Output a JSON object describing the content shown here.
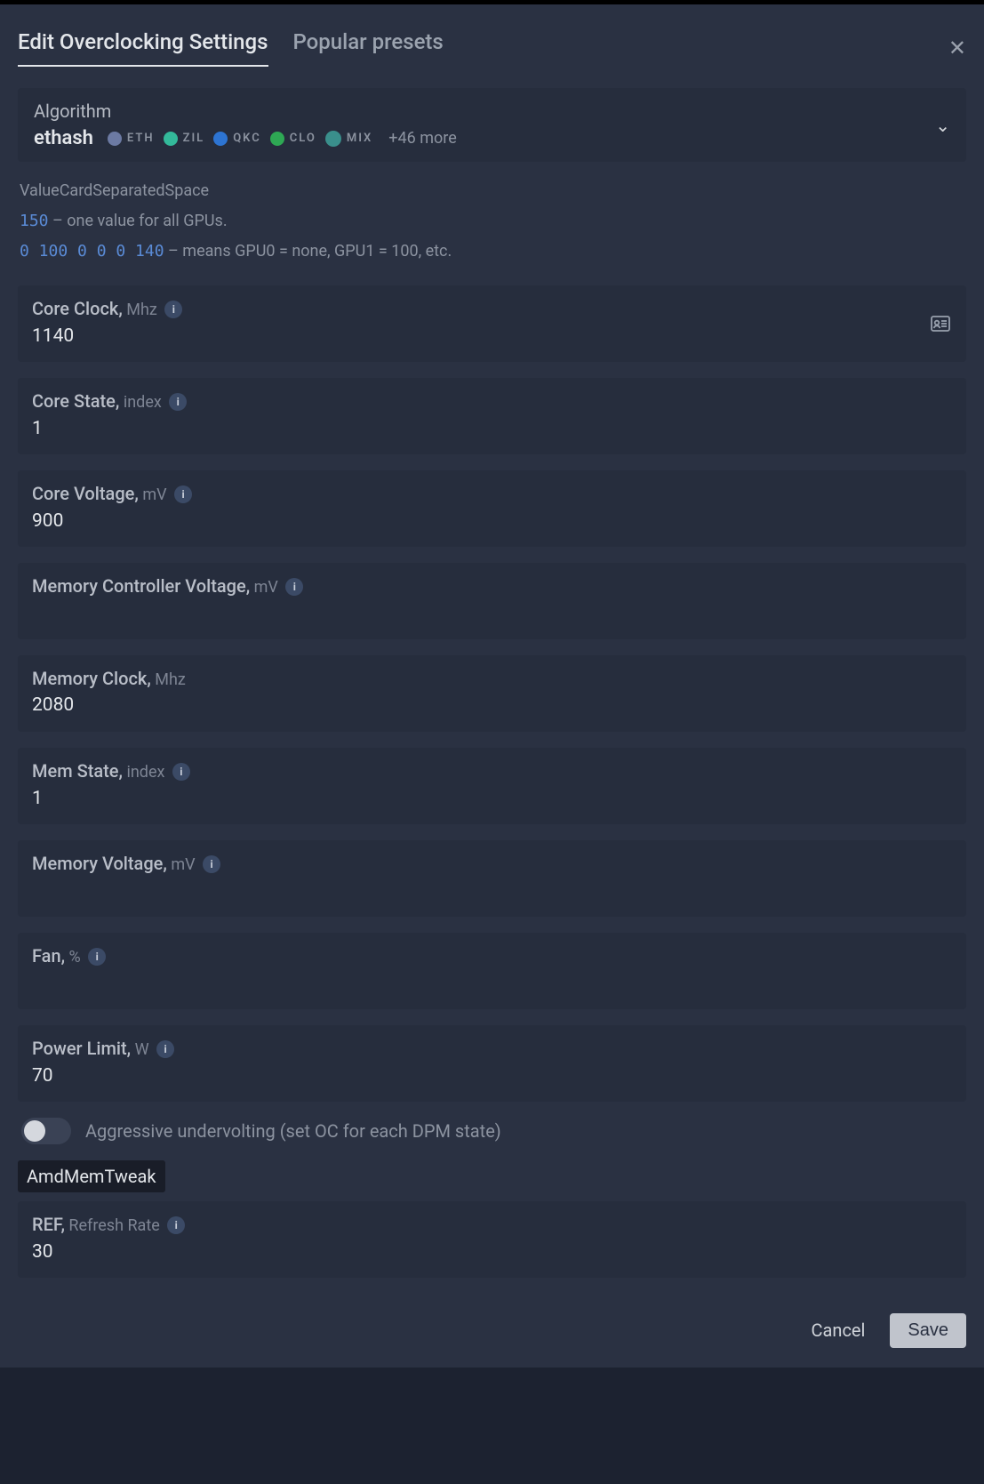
{
  "tabs": {
    "active": "Edit Overclocking Settings",
    "inactive": "Popular presets"
  },
  "algorithm": {
    "label": "Algorithm",
    "name": "ethash",
    "coins": [
      {
        "symbol": "ETH",
        "class": "eth"
      },
      {
        "symbol": "ZIL",
        "class": "zil"
      },
      {
        "symbol": "QKC",
        "class": "qkc"
      },
      {
        "symbol": "CLO",
        "class": "clo"
      },
      {
        "symbol": "MIX",
        "class": "mix"
      }
    ],
    "more": "+46 more"
  },
  "help": {
    "title": "ValueCardSeparatedSpace",
    "line1_code": "150",
    "line1_text": " – one value for all GPUs.",
    "line2_code": "0 100 0 0 0 140",
    "line2_text": " – means GPU0 = none, GPU1 = 100, etc."
  },
  "fields": {
    "core_clock": {
      "label": "Core Clock,",
      "unit": "Mhz",
      "info": true,
      "value": "1140",
      "contact_icon": true
    },
    "core_state": {
      "label": "Core State,",
      "unit": "index",
      "info": true,
      "value": "1"
    },
    "core_voltage": {
      "label": "Core Voltage,",
      "unit": "mV",
      "info": true,
      "value": "900"
    },
    "mem_ctrl_v": {
      "label": "Memory Controller Voltage,",
      "unit": "mV",
      "info": true,
      "value": ""
    },
    "mem_clock": {
      "label": "Memory Clock,",
      "unit": "Mhz",
      "info": false,
      "value": "2080"
    },
    "mem_state": {
      "label": "Mem State,",
      "unit": "index",
      "info": true,
      "value": "1"
    },
    "mem_voltage": {
      "label": "Memory Voltage,",
      "unit": "mV",
      "info": true,
      "value": ""
    },
    "fan": {
      "label": "Fan,",
      "unit": "%",
      "info": true,
      "value": ""
    },
    "power_limit": {
      "label": "Power Limit,",
      "unit": "W",
      "info": true,
      "value": "70"
    },
    "ref": {
      "label": "REF,",
      "unit": "Refresh Rate",
      "info": true,
      "value": "30"
    }
  },
  "toggle": {
    "label": "Aggressive undervolting (set OC for each DPM state)"
  },
  "section": {
    "amt": "AmdMemTweak"
  },
  "footer": {
    "cancel": "Cancel",
    "save": "Save"
  },
  "info_glyph": "i"
}
